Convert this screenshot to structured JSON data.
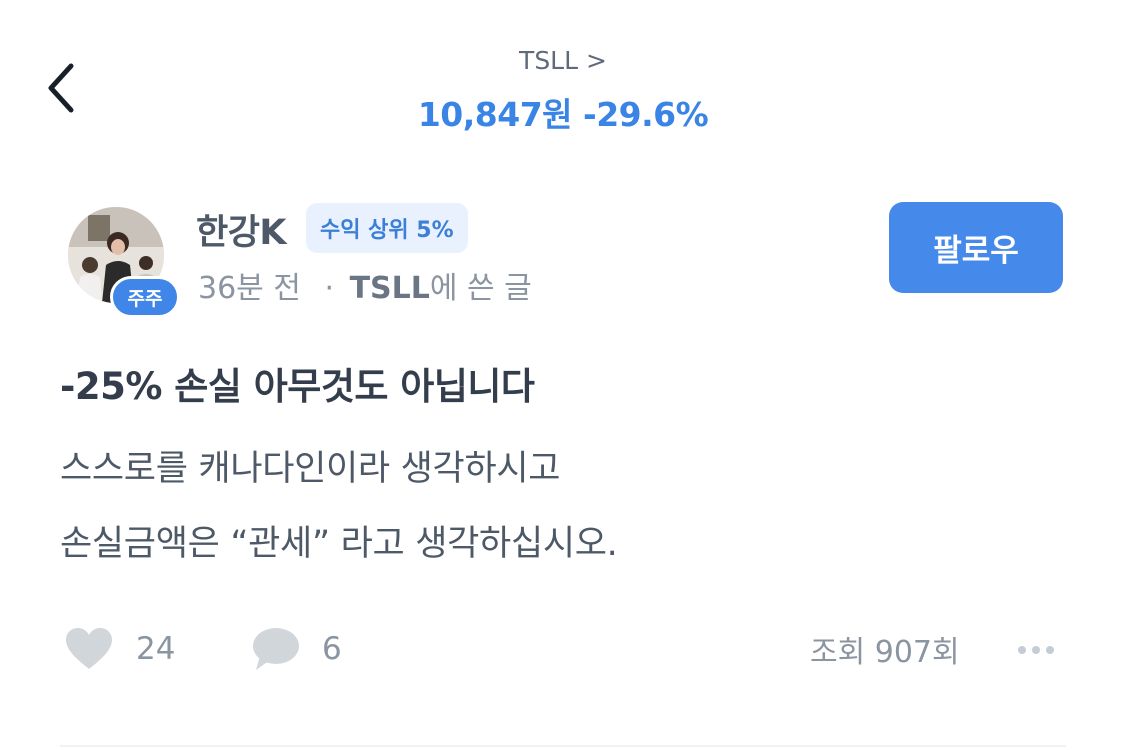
{
  "header": {
    "ticker": "TSLL >",
    "price": "10,847원 -29.6%"
  },
  "author": {
    "name": "한강K",
    "rank_badge": "수익 상위 5%",
    "avatar_badge": "주주",
    "time": "36분 전",
    "separator": "·",
    "board_ticker": "TSLL",
    "board_suffix": "에 쓴 글"
  },
  "follow_label": "팔로우",
  "post": {
    "title": "-25% 손실 아무것도 아닙니다",
    "lines": [
      "스스로를 캐나다인이라 생각하시고",
      "손실금액은 “관세” 라고 생각하십시오."
    ]
  },
  "stats": {
    "likes": "24",
    "comments": "6",
    "views": "조회 907회"
  },
  "icons": {
    "back": "chevron-left-icon",
    "like": "heart-icon",
    "comment": "speech-bubble-icon",
    "more": "more-dots-icon"
  },
  "colors": {
    "accent": "#3a84e6",
    "follow_button": "#4589ea",
    "rank_badge_bg": "#e8f1fd",
    "muted_text": "#8b95a1",
    "icon_gray": "#d1d6db"
  }
}
